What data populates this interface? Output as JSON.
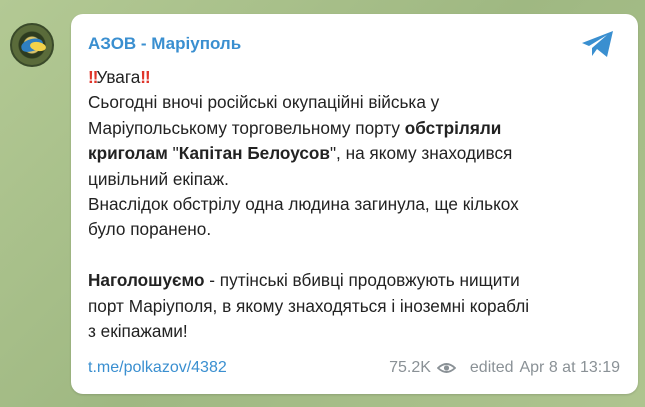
{
  "channel": {
    "name": "АЗОВ - Маріуполь"
  },
  "message": {
    "warning_label": "Увага",
    "warning_marks": "‼",
    "line1": "Сьогодні вночі російські окупаційні війська у",
    "line2_plain": "Маріупольському торговельному порту ",
    "line2_bold": "обстріляли",
    "line3_bold_a": "криголам",
    "line3_quote_open": " \"",
    "line3_bold_b": "Капітан Белоусов",
    "line3_rest": "\", на якому знаходився",
    "line4": "цивільний екіпаж.",
    "line5": "Внаслідок обстрілу одна людина загинула, ще кількох",
    "line6": "було поранено.",
    "line7_bold": "Наголошуємо",
    "line7_rest": " - путінські вбивці продовжують нищити",
    "line8": "порт Маріуполя, в якому знаходяться і іноземні кораблі",
    "line9": "з екіпажами!"
  },
  "footer": {
    "link": "t.me/polkazov/4382",
    "views": "75.2K",
    "edited": "edited",
    "date": "Apr 8 at 13:19"
  },
  "icons": {
    "share": "telegram-plane-icon",
    "views": "eye-icon"
  },
  "colors": {
    "accent": "#3a8fd0",
    "warning": "#e0352a",
    "background": "#a9c08e"
  }
}
